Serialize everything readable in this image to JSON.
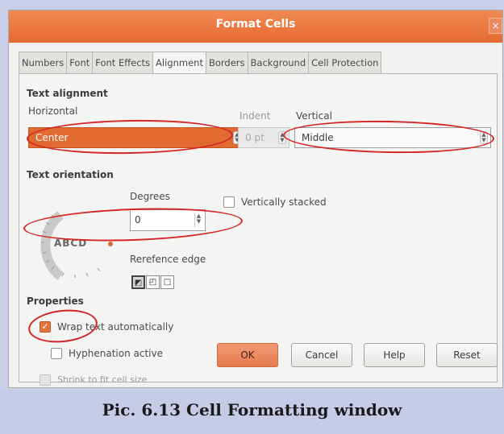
{
  "window": {
    "title": "Format Cells",
    "close_glyph": "×"
  },
  "tabs": [
    {
      "label": "Numbers"
    },
    {
      "label": "Font"
    },
    {
      "label": "Font Effects"
    },
    {
      "label": "Alignment",
      "active": true
    },
    {
      "label": "Borders"
    },
    {
      "label": "Background"
    },
    {
      "label": "Cell Protection"
    }
  ],
  "text_alignment": {
    "heading": "Text alignment",
    "horizontal_label": "Horizontal",
    "horizontal_value": "Center",
    "indent_label": "Indent",
    "indent_value": "0 pt",
    "vertical_label": "Vertical",
    "vertical_value": "Middle"
  },
  "text_orientation": {
    "heading": "Text orientation",
    "degrees_label": "Degrees",
    "degrees_value": "0",
    "dial_text": "ABCD",
    "vertically_stacked_label": "Vertically stacked",
    "vertically_stacked_checked": false,
    "reference_edge_label": "Rerefence edge",
    "reference_edge_icons": [
      "edge-bottom-icon",
      "edge-top-icon",
      "edge-inside-icon"
    ]
  },
  "properties": {
    "heading": "Properties",
    "wrap_label": "Wrap text automatically",
    "wrap_checked": true,
    "hyphenation_label": "Hyphenation active",
    "hyphenation_checked": false,
    "shrink_label": "Shrink to fit cell size",
    "shrink_checked": false
  },
  "buttons": {
    "ok": "OK",
    "cancel": "Cancel",
    "help": "Help",
    "reset": "Reset"
  },
  "caption": "Pic. 6.13 Cell Formatting window",
  "colors": {
    "accent": "#e06a30",
    "highlight_ellipse": "#d32626",
    "caption_bg": "#c6cbe8"
  }
}
